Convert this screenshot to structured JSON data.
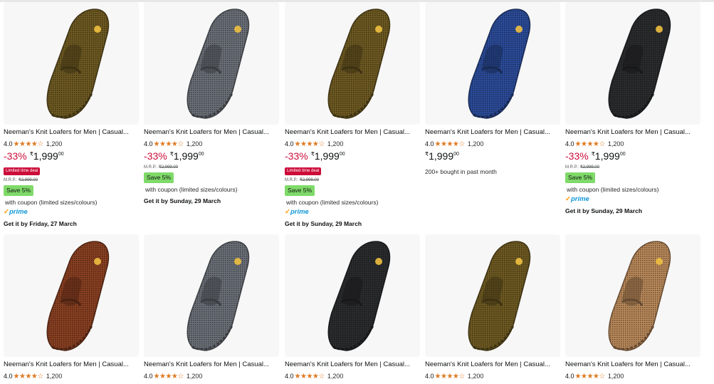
{
  "products": [
    {
      "title": "Neeman's Knit Loafers for Men | Casual...",
      "rating": "4.0",
      "stars": "★★★★☆",
      "count": "1,200",
      "discount": "-33%",
      "currency": "₹",
      "price": "1,999",
      "fraction": "00",
      "deal": "Limited time deal",
      "mrp_label": "M.R.P.:",
      "mrp": "₹2,999.00",
      "save": "Save 5%",
      "coupon": "with coupon (limited sizes/colours)",
      "bought": "",
      "prime": "prime",
      "delivery": "Get it by Friday, 27 March",
      "color": "#6e5a22"
    },
    {
      "title": "Neeman's Knit Loafers for Men | Casual...",
      "rating": "4.0",
      "stars": "★★★★☆",
      "count": "1,200",
      "discount": "-33%",
      "currency": "₹",
      "price": "1,999",
      "fraction": "00",
      "deal": "",
      "mrp_label": "M.R.P.:",
      "mrp": "₹2,999.00",
      "save": "Save 5%",
      "coupon": "with coupon (limited sizes/colours)",
      "bought": "",
      "prime": "",
      "delivery": "Get it by Sunday, 29 March",
      "color": "#6b7078"
    },
    {
      "title": "Neeman's Knit Loafers for Men | Casual...",
      "rating": "4.0",
      "stars": "★★★★☆",
      "count": "1,200",
      "discount": "-33%",
      "currency": "₹",
      "price": "1,999",
      "fraction": "00",
      "deal": "Limited time deal",
      "mrp_label": "M.R.P.:",
      "mrp": "₹2,999.00",
      "save": "Save 5%",
      "coupon": "with coupon (limited sizes/colours)",
      "bought": "",
      "prime": "prime",
      "delivery": "Get it by Sunday, 29 March",
      "color": "#6e5a22"
    },
    {
      "title": "Neeman's Knit Loafers for Men | Casual...",
      "rating": "4.0",
      "stars": "★★★★☆",
      "count": "1,200",
      "discount": "",
      "currency": "₹",
      "price": "1,999",
      "fraction": "00",
      "deal": "",
      "mrp_label": "",
      "mrp": "",
      "save": "",
      "coupon": "",
      "bought": "200+ bought in past month",
      "prime": "",
      "delivery": "",
      "color": "#2c4c9a"
    },
    {
      "title": "Neeman's Knit Loafers for Men | Casual...",
      "rating": "4.0",
      "stars": "★★★★☆",
      "count": "1,200",
      "discount": "-33%",
      "currency": "₹",
      "price": "1,999",
      "fraction": "00",
      "deal": "",
      "mrp_label": "M.R.P.:",
      "mrp": "₹2,999.00",
      "save": "Save 5%",
      "coupon": "with coupon (limited sizes/colours)",
      "bought": "",
      "prime": "prime",
      "delivery": "Get it by Sunday, 29 March",
      "color": "#2a2c2e"
    },
    {
      "title": "Neeman's Knit Loafers for Men | Casual...",
      "rating": "4.0",
      "stars": "★★★★☆",
      "count": "1,200",
      "discount": "",
      "currency": "",
      "price": "",
      "fraction": "",
      "deal": "",
      "mrp_label": "",
      "mrp": "",
      "save": "",
      "coupon": "",
      "bought": "",
      "prime": "",
      "delivery": "",
      "color": "#8a4022"
    },
    {
      "title": "Neeman's Knit Loafers for Men | Casual...",
      "rating": "4.0",
      "stars": "★★★★☆",
      "count": "1,200",
      "discount": "",
      "currency": "",
      "price": "",
      "fraction": "",
      "deal": "",
      "mrp_label": "",
      "mrp": "",
      "save": "",
      "coupon": "",
      "bought": "",
      "prime": "",
      "delivery": "",
      "color": "#6b7078"
    },
    {
      "title": "Neeman's Knit Loafers for Men | Casual...",
      "rating": "4.0",
      "stars": "★★★★☆",
      "count": "1,200",
      "discount": "",
      "currency": "",
      "price": "",
      "fraction": "",
      "deal": "",
      "mrp_label": "",
      "mrp": "",
      "save": "",
      "coupon": "",
      "bought": "",
      "prime": "",
      "delivery": "",
      "color": "#2a2c2e"
    },
    {
      "title": "Neeman's Knit Loafers for Men | Casual...",
      "rating": "4.0",
      "stars": "★★★★☆",
      "count": "1,200",
      "discount": "",
      "currency": "",
      "price": "",
      "fraction": "",
      "deal": "",
      "mrp_label": "",
      "mrp": "",
      "save": "",
      "coupon": "",
      "bought": "",
      "prime": "",
      "delivery": "",
      "color": "#6e5a22"
    },
    {
      "title": "Neeman's Knit Loafers for Men | Casual...",
      "rating": "4.0",
      "stars": "★★★★☆",
      "count": "1,200",
      "discount": "",
      "currency": "",
      "price": "",
      "fraction": "",
      "deal": "",
      "mrp_label": "",
      "mrp": "",
      "save": "",
      "coupon": "",
      "bought": "",
      "prime": "",
      "delivery": "",
      "color": "#b9895a"
    }
  ]
}
